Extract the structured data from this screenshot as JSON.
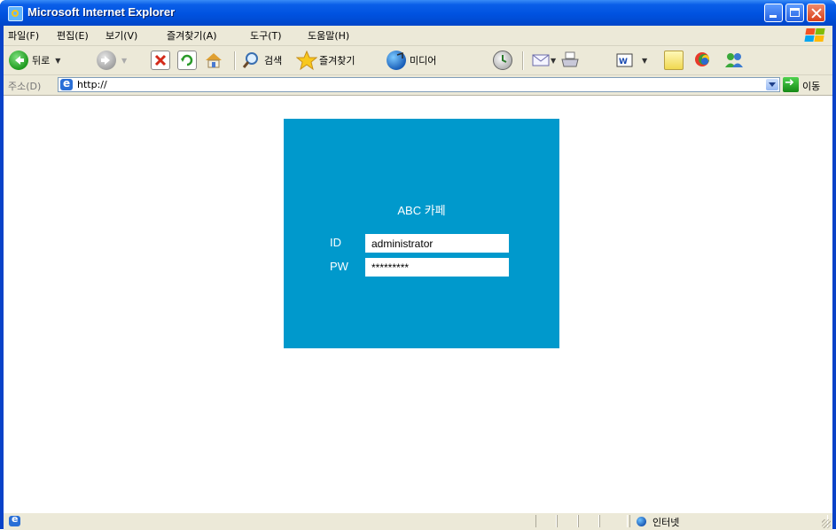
{
  "window": {
    "title": "Microsoft Internet Explorer",
    "titlebar_color": "#0054e3",
    "close_color": "#e0451f"
  },
  "menubar": {
    "items": [
      "파일(F)",
      "편집(E)",
      "보기(V)",
      "즐겨찾기(A)",
      "도구(T)",
      "도움말(H)"
    ]
  },
  "toolbar": {
    "back_label": "뒤로",
    "search_label": "검색",
    "favorites_label": "즐겨찾기",
    "media_label": "미디어",
    "icons": [
      "back-icon",
      "forward-icon",
      "stop-icon",
      "refresh-icon",
      "home-icon",
      "search-icon",
      "favorites-star-icon",
      "media-icon",
      "history-icon",
      "mail-icon",
      "print-icon",
      "edit-icon",
      "discuss-icon",
      "messenger-icon",
      "contacts-icon"
    ]
  },
  "address": {
    "label": "주소(D)",
    "url": "http://",
    "go_label": "이동"
  },
  "login": {
    "panel_color": "#0099cc",
    "site_title": "ABC 카페",
    "id_label": "ID",
    "id_value": "administrator",
    "pw_label": "PW",
    "pw_value": "*********"
  },
  "status": {
    "zone": "인터넷"
  }
}
